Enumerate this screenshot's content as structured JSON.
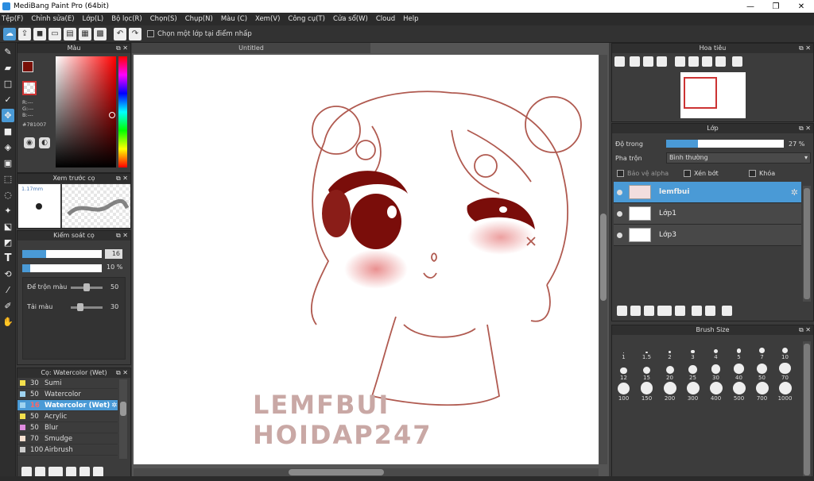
{
  "app": {
    "title": "MediBang Paint Pro (64bit)",
    "min": "—",
    "max": "❐",
    "close": "✕"
  },
  "menu": [
    "Tệp(F)",
    "Chỉnh sửa(E)",
    "Lớp(L)",
    "Bộ lọc(R)",
    "Chọn(S)",
    "Chụp(N)",
    "Màu (C)",
    "Xem(V)",
    "Công cụ(T)",
    "Cửa sổ(W)",
    "Cloud",
    "Help"
  ],
  "toolbar": {
    "checkbox_label": "Chọn một lớp tại điểm nhấp"
  },
  "color_panel": {
    "title": "Màu",
    "r": "R:---",
    "g": "G:---",
    "b": "B:---",
    "hex": "#781007",
    "color": "#781007"
  },
  "brush_preview": {
    "title": "Xem trước cọ",
    "size": "1.17mm"
  },
  "brush_control": {
    "title": "Kiểm soát cọ",
    "size_value": "16",
    "opacity_value": "10 %",
    "size_fraction": 0.3,
    "opacity_fraction": 0.1,
    "blend_label": "Để trộn màu",
    "blend_value": "50",
    "blend_fraction": 0.5,
    "reload_label": "Tải màu",
    "reload_value": "30",
    "reload_fraction": 0.3
  },
  "brush_list": {
    "title": "Cọ: Watercolor (Wet)",
    "items": [
      {
        "size": "30",
        "name": "Sumi",
        "color": "#f4e04d"
      },
      {
        "size": "50",
        "name": "Watercolor",
        "color": "#9fd3f0"
      },
      {
        "size": "16",
        "name": "Watercolor (Wet)",
        "color": "#9fd3f0"
      },
      {
        "size": "50",
        "name": "Acrylic",
        "color": "#f4e04d"
      },
      {
        "size": "50",
        "name": "Blur",
        "color": "#e08ce0"
      },
      {
        "size": "70",
        "name": "Smudge",
        "color": "#f7e0d0"
      },
      {
        "size": "100",
        "name": "Airbrush",
        "color": "#cccccc"
      }
    ]
  },
  "canvas": {
    "tab": "Untitled",
    "watermark_1": "LEMFBUI",
    "watermark_2": "HOIDAP247"
  },
  "navigator": {
    "title": "Hoa tiêu"
  },
  "layers": {
    "title": "Lớp",
    "opacity_label": "Độ trong",
    "opacity_value": "27 %",
    "opacity_fraction": 0.27,
    "blend_label": "Pha trộn",
    "blend_value": "Bình thường",
    "protect_alpha": "Bảo vệ alpha",
    "clip": "Xén bớt",
    "lock": "Khóa",
    "items": [
      {
        "name": "lemfbui"
      },
      {
        "name": "Lớp1"
      },
      {
        "name": "Lớp3"
      }
    ]
  },
  "brush_size": {
    "title": "Brush Size",
    "sizes": [
      "1",
      "1.5",
      "2",
      "3",
      "4",
      "5",
      "7",
      "10",
      "12",
      "15",
      "20",
      "25",
      "30",
      "40",
      "50",
      "70",
      "100",
      "150",
      "200",
      "300",
      "400",
      "500",
      "700",
      "1000"
    ]
  }
}
